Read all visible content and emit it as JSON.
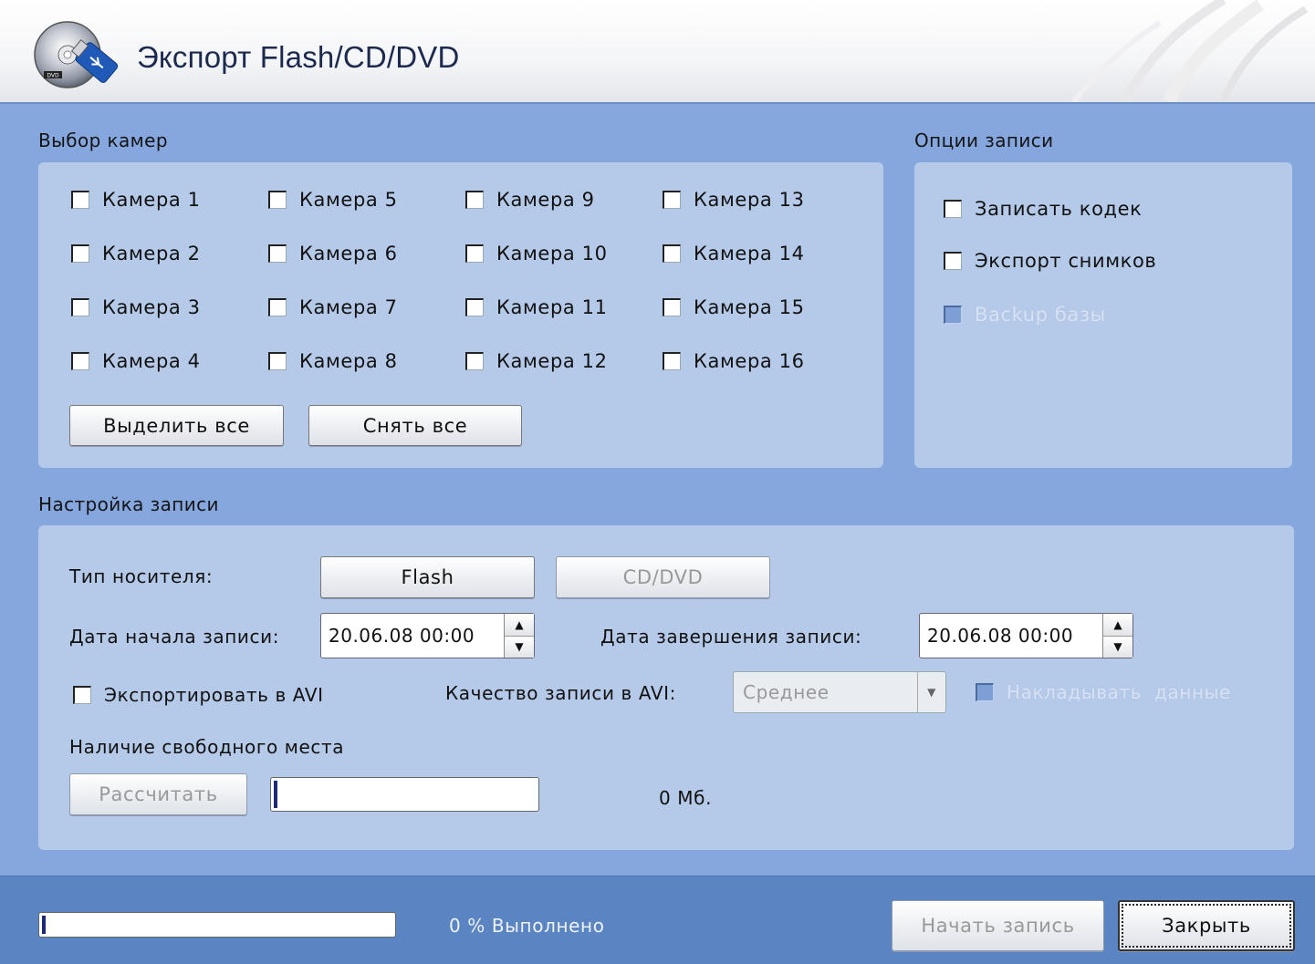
{
  "window": {
    "title": "Экспорт Flash/CD/DVD"
  },
  "cameras": {
    "label": "Выбор камер",
    "items": [
      "Камера 1",
      "Камера 2",
      "Камера 3",
      "Камера 4",
      "Камера 5",
      "Камера 6",
      "Камера 7",
      "Камера 8",
      "Камера 9",
      "Камера 10",
      "Камера 11",
      "Камера 12",
      "Камера 13",
      "Камера 14",
      "Камера 15",
      "Камера 16"
    ],
    "select_all": "Выделить все",
    "deselect_all": "Снять все"
  },
  "options": {
    "label": "Опции записи",
    "write_codec": "Записать кодек",
    "export_snapshots": "Экспорт снимков",
    "backup_db": "Backup базы"
  },
  "settings": {
    "label": "Настройка записи",
    "media_type_label": "Тип носителя:",
    "media_flash": "Flash",
    "media_cddvd": "CD/DVD",
    "start_label": "Дата начала записи:",
    "start_value": "20.06.08 00:00",
    "end_label": "Дата завершения записи:",
    "end_value": "20.06.08 00:00",
    "export_avi": "Экспортировать в AVI",
    "avi_quality_label": "Качество записи в AVI:",
    "avi_quality_value": "Среднее",
    "overlay_data": "Накладывать  данные",
    "free_space_label": "Наличие свободного места",
    "calculate": "Рассчитать",
    "free_space_value": "0 Мб.",
    "free_space_progress": 0
  },
  "footer": {
    "progress": 0,
    "progress_text": "0 % Выполнено",
    "start_record": "Начать запись",
    "close": "Закрыть"
  },
  "colors": {
    "background": "#84a6dc",
    "panel": "#b5c9e8",
    "footer": "#5b84c2",
    "progress_fill": "#1e2a78"
  }
}
